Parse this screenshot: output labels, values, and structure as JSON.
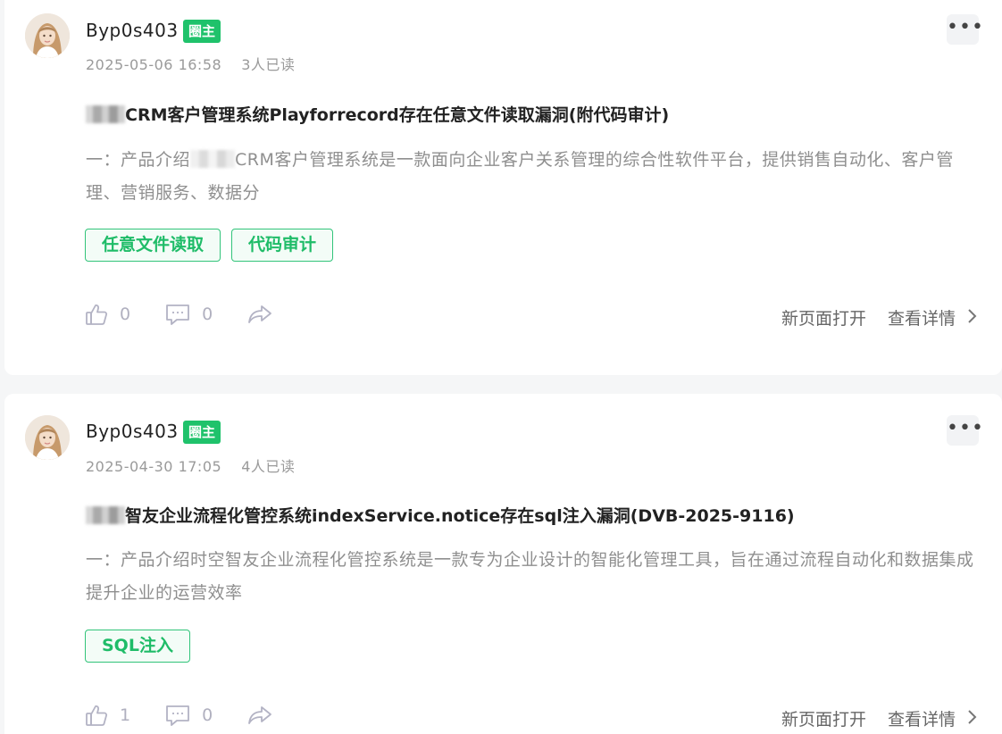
{
  "posts": [
    {
      "author": "Byp0s403",
      "role_badge": "圈主",
      "datetime": "2025-05-06 16:58",
      "read_count": "3人已读",
      "title": "CRM客户管理系统Playforrecord存在任意文件读取漏洞(附代码审计)",
      "summary_part1": "一：产品介绍",
      "summary_part2": "CRM客户管理系统是一款面向企业客户关系管理的综合性软件平台，提供销售自动化、客户管理、营销服务、数据分",
      "tags": [
        "任意文件读取",
        "代码审计"
      ],
      "like_count": "0",
      "comment_count": "0",
      "open_new_label": "新页面打开",
      "details_label": "查看详情"
    },
    {
      "author": "Byp0s403",
      "role_badge": "圈主",
      "datetime": "2025-04-30 17:05",
      "read_count": "4人已读",
      "title": "智友企业流程化管控系统indexService.notice存在sql注入漏洞(DVB-2025-9116)",
      "summary": "一：产品介绍时空智友企业流程化管控系统是一款专为企业设计的智能化管理工具，旨在通过流程自动化和数据集成提升企业的运营效率",
      "tags": [
        "SQL注入"
      ],
      "like_count": "1",
      "comment_count": "0",
      "open_new_label": "新页面打开",
      "details_label": "查看详情"
    }
  ],
  "icons": {
    "more": "more-dots-icon",
    "like": "thumbs-up-icon",
    "comment": "comment-icon",
    "share": "share-icon",
    "chevron": "chevron-right-icon"
  },
  "colors": {
    "badge_green": "#1fc26b",
    "tag_green": "#1fbc68",
    "muted_text": "#8f8f8f"
  }
}
